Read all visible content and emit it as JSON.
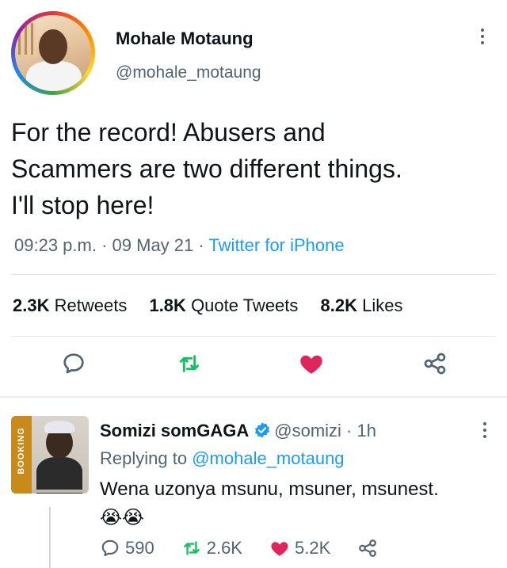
{
  "tweet": {
    "author_name": "Mohale Motaung",
    "author_handle": "@mohale_motaung",
    "text_lines": [
      "For the record! Abusers and",
      "Scammers are two different things.",
      "I'll stop here!"
    ],
    "time": "09:23 p.m.",
    "date": "09 May 21",
    "separator": "·",
    "source": "Twitter for iPhone",
    "stats": {
      "retweets_count": "2.3K",
      "retweets_label": "Retweets",
      "quotes_count": "1.8K",
      "quotes_label": "Quote Tweets",
      "likes_count": "8.2K",
      "likes_label": "Likes"
    },
    "actions": [
      "reply-icon",
      "retweet-icon",
      "like-icon",
      "share-icon"
    ],
    "colors": {
      "retweet": "#17bf63",
      "like": "#e0245e",
      "link": "#1d9bf0",
      "muted": "#536471"
    }
  },
  "reply": {
    "author_name": "Somizi somGAGA",
    "author_handle": "@somizi",
    "age": "· 1h",
    "avatar_text": "BOOKING",
    "replying_prefix": "Replying to",
    "replying_to": "@mohale_motaung",
    "text": "Wena uzonya msunu, msuner, msunest.",
    "emoji": "😭😭",
    "counts": {
      "replies": "590",
      "retweets": "2.6K",
      "likes": "5.2K"
    }
  }
}
